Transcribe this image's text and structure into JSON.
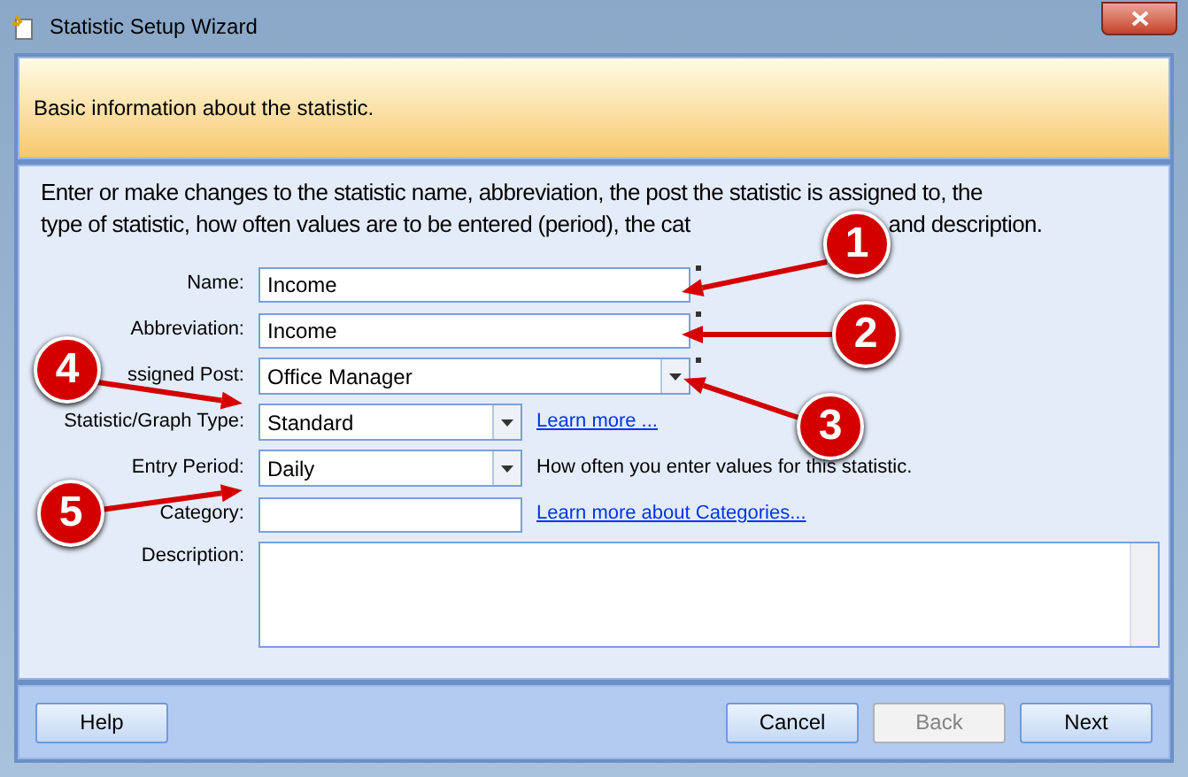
{
  "window": {
    "title": "Statistic Setup Wizard"
  },
  "header": {
    "text": "Basic information about the statistic."
  },
  "intro_line_1": "Enter or make changes to the statistic name, abbreviation, the post the statistic is assigned to, the",
  "intro_line_2": "type of statistic, how often values are to be entered (period), the cat",
  "intro_end": "and description.",
  "fields": [
    {
      "kind": "text",
      "label": "Name:",
      "value": "Income",
      "required": true
    },
    {
      "kind": "text",
      "label": "Abbreviation:",
      "value": "Income",
      "required": true
    },
    {
      "kind": "combo",
      "label": "ssigned Post:",
      "value": "Office Manager",
      "wide": true,
      "required": true
    },
    {
      "kind": "combo",
      "label": "Statistic/Graph Type:",
      "value": "Standard",
      "link": "Learn more ..."
    },
    {
      "kind": "combo",
      "label": "Entry Period:",
      "value": "Daily",
      "note": "How often you enter values for this statistic."
    },
    {
      "kind": "text",
      "label": "Category:",
      "link": "Learn more about Categories..."
    },
    {
      "kind": "memo",
      "label": "Description:"
    }
  ],
  "callouts": [
    {
      "number": "1"
    },
    {
      "number": "2"
    },
    {
      "number": "3"
    },
    {
      "number": "4"
    },
    {
      "number": "5"
    }
  ],
  "buttons": [
    {
      "label": "Help",
      "disabled": false
    },
    {
      "label": "Cancel",
      "disabled": false
    },
    {
      "label": "Back",
      "disabled": true
    },
    {
      "label": "Next",
      "disabled": false
    }
  ]
}
